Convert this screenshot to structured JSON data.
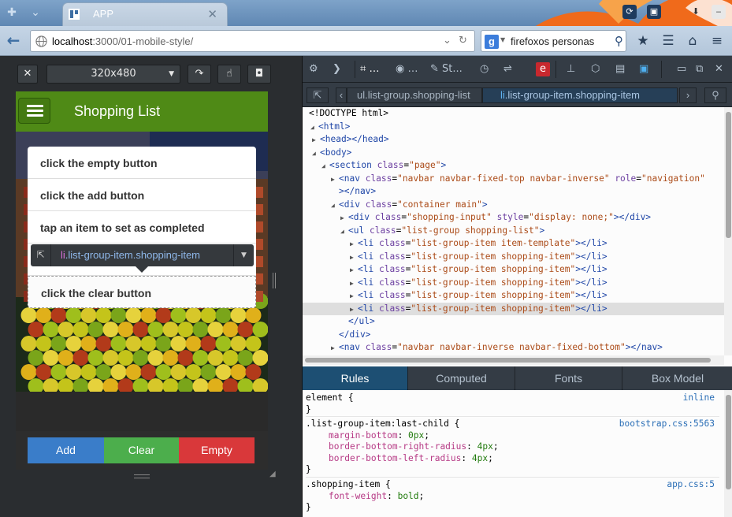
{
  "browser": {
    "tab_title": "APP",
    "url_host": "localhost",
    "url_path": ":3000/01-mobile-style/",
    "search_query": "firefoxos personas"
  },
  "responsive": {
    "size_label": "320x480"
  },
  "app": {
    "title": "Shopping List",
    "items": [
      "click the empty button",
      "click the add button",
      "tap an item to set as completed",
      "",
      "click the clear button"
    ],
    "infobar": {
      "tag": "li",
      "classes": ".list-group-item.shopping-item"
    },
    "buttons": {
      "add": "Add",
      "clear": "Clear",
      "empty": "Empty"
    },
    "colors": {
      "header": "#4f8a16",
      "add": "#3a7dc9",
      "clear": "#4cae4c",
      "empty": "#d9383a"
    }
  },
  "devtools": {
    "toolbar": {
      "tab_st": "St..."
    },
    "breadcrumbs": {
      "crumb1": "ul.list-group.shopping-list",
      "crumb2_tag": "li",
      "crumb2_classes": ".list-group-item.shopping-item"
    },
    "markup": {
      "doctype": "<!DOCTYPE html>",
      "html": "<html>",
      "head": "<head></head>",
      "body": "<body>",
      "section": {
        "tag": "<section",
        "attr": "class",
        "val": "\"page\"",
        "end": ">"
      },
      "nav1": {
        "tag": "<nav",
        "a1": "class",
        "v1": "\"navbar navbar-fixed-top navbar-inverse\"",
        "a2": "role",
        "v2": "\"navigation\""
      },
      "nav1_close": "></nav>",
      "div_main": {
        "tag": "<div",
        "attr": "class",
        "val": "\"container main\"",
        "end": ">"
      },
      "div_input": {
        "tag": "<div",
        "a1": "class",
        "v1": "\"shopping-input\"",
        "a2": "style",
        "v2": "\"display: none;\"",
        "end": "></div>"
      },
      "ul": {
        "tag": "<ul",
        "attr": "class",
        "val": "\"list-group shopping-list\"",
        "end": ">"
      },
      "li_rows": [
        {
          "val": "\"list-group-item item-template\""
        },
        {
          "val": "\"list-group-item shopping-item\""
        },
        {
          "val": "\"list-group-item shopping-item\""
        },
        {
          "val": "\"list-group-item shopping-item\""
        },
        {
          "val": "\"list-group-item shopping-item\""
        },
        {
          "val": "\"list-group-item shopping-item\""
        }
      ],
      "li_tag": "<li",
      "li_attr": "class",
      "li_end": "></li>",
      "ul_close": "</ul>",
      "div_close": "</div>",
      "nav2": {
        "tag": "<nav",
        "attr": "class",
        "val": "\"navbar navbar-inverse navbar-fixed-bottom\"",
        "end": "></nav>"
      }
    },
    "rules_tabs": [
      "Rules",
      "Computed",
      "Fonts",
      "Box Model"
    ],
    "rules": {
      "r1_selector": "element {",
      "r1_src": "inline",
      "close": "}",
      "r2_selector": ".list-group-item:last-child {",
      "r2_src": "bootstrap.css:5563",
      "r2_props": [
        {
          "name": "margin-bottom",
          "value": "0px"
        },
        {
          "name": "border-bottom-right-radius",
          "value": "4px"
        },
        {
          "name": "border-bottom-left-radius",
          "value": "4px"
        }
      ],
      "r3_selector": ".shopping-item {",
      "r3_src": "app.css:5",
      "r3_props": [
        {
          "name": "font-weight",
          "value": "bold"
        }
      ]
    }
  }
}
